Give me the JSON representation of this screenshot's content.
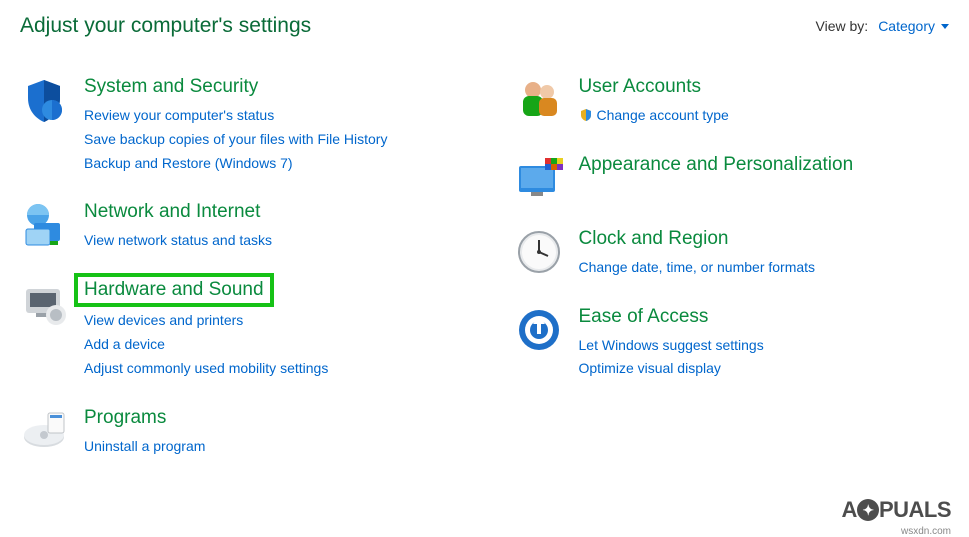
{
  "header": {
    "title": "Adjust your computer's settings",
    "viewByLabel": "View by:",
    "viewByValue": "Category"
  },
  "left": [
    {
      "icon": "shield-icon",
      "title": "System and Security",
      "tasks": [
        "Review your computer's status",
        "Save backup copies of your files with File History",
        "Backup and Restore (Windows 7)"
      ]
    },
    {
      "icon": "network-icon",
      "title": "Network and Internet",
      "tasks": [
        "View network status and tasks"
      ]
    },
    {
      "icon": "hardware-icon",
      "title": "Hardware and Sound",
      "highlighted": true,
      "tasks": [
        "View devices and printers",
        "Add a device",
        "Adjust commonly used mobility settings"
      ]
    },
    {
      "icon": "programs-icon",
      "title": "Programs",
      "tasks": [
        "Uninstall a program"
      ]
    }
  ],
  "right": [
    {
      "icon": "users-icon",
      "title": "User Accounts",
      "tasks": [
        {
          "shield": true,
          "label": "Change account type"
        }
      ]
    },
    {
      "icon": "appearance-icon",
      "title": "Appearance and Personalization",
      "tasks": []
    },
    {
      "icon": "clock-icon",
      "title": "Clock and Region",
      "tasks": [
        "Change date, time, or number formats"
      ]
    },
    {
      "icon": "ease-icon",
      "title": "Ease of Access",
      "tasks": [
        "Let Windows suggest settings",
        "Optimize visual display"
      ]
    }
  ],
  "watermark": {
    "brand": "A🅿️PUALS",
    "sub": "wsxdn.com"
  }
}
